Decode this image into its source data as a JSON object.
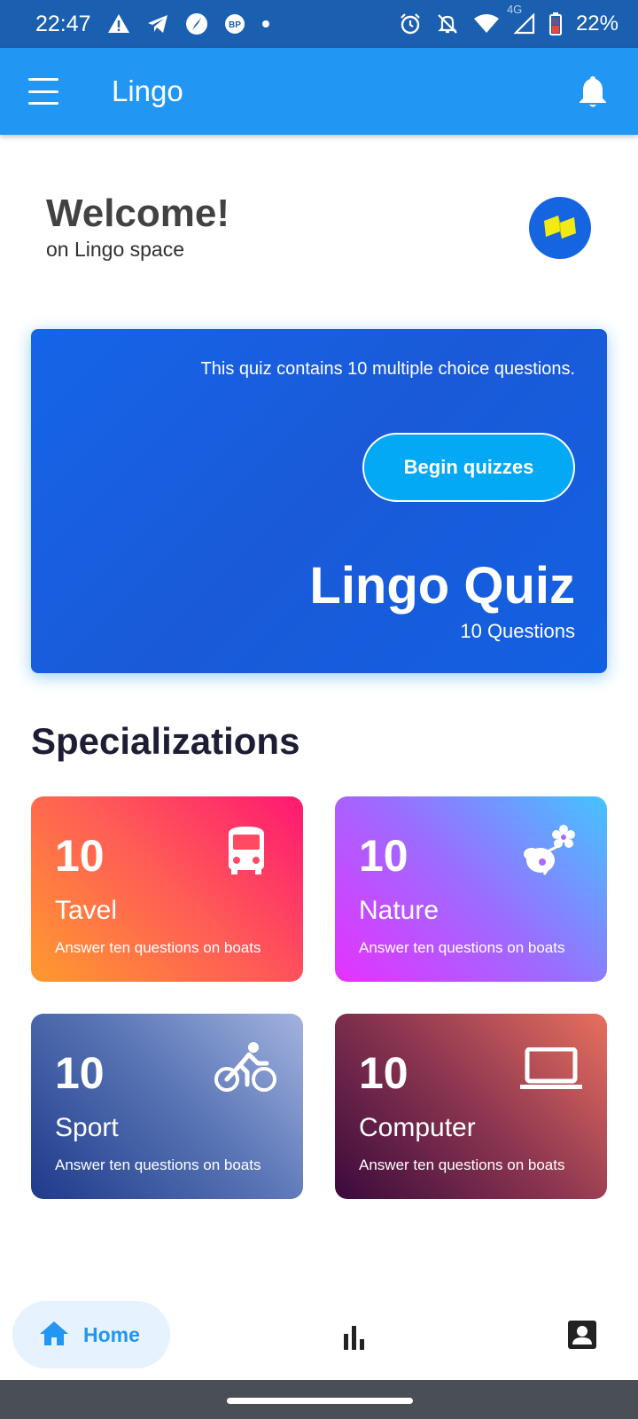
{
  "status_bar": {
    "time": "22:47",
    "battery": "22%",
    "network": "4G",
    "left_icons": [
      "alert-icon",
      "telegram-icon",
      "compass-icon",
      "bp-icon",
      "dot-icon"
    ],
    "right_icons": [
      "alarm-icon",
      "bell-off-icon",
      "wifi-icon",
      "signal-icon",
      "battery-icon"
    ],
    "bp_label": "BP"
  },
  "app_bar": {
    "title": "Lingo",
    "menu_icon": "menu-icon",
    "notification_icon": "bell-icon"
  },
  "welcome": {
    "title": "Welcome!",
    "subtitle": "on Lingo space"
  },
  "quiz_card": {
    "description": "This quiz contains 10 multiple choice questions.",
    "button_label": "Begin quizzes",
    "title": "Lingo Quiz",
    "count_label": "10 Questions"
  },
  "specializations": {
    "heading": "Specializations",
    "cards": [
      {
        "count": "10",
        "name": "Tavel",
        "description": "Answer ten questions on boats",
        "icon": "bus-icon"
      },
      {
        "count": "10",
        "name": "Nature",
        "description": "Answer ten questions on boats",
        "icon": "nature-icon"
      },
      {
        "count": "10",
        "name": "Sport",
        "description": "Answer ten questions on boats",
        "icon": "bicycle-icon"
      },
      {
        "count": "10",
        "name": "Computer",
        "description": "Answer ten questions on boats",
        "icon": "laptop-icon"
      }
    ]
  },
  "bottom_nav": {
    "items": [
      {
        "label": "Home",
        "icon": "home-icon",
        "active": true
      },
      {
        "label": "",
        "icon": "bar-chart-icon",
        "active": false
      },
      {
        "label": "",
        "icon": "profile-icon",
        "active": false
      }
    ],
    "active_color": "#2196f3"
  },
  "colors": {
    "status_bar": "#1a5fb0",
    "app_bar": "#2196f3",
    "quiz_card": "#1565e8",
    "button": "#03a9f4"
  }
}
